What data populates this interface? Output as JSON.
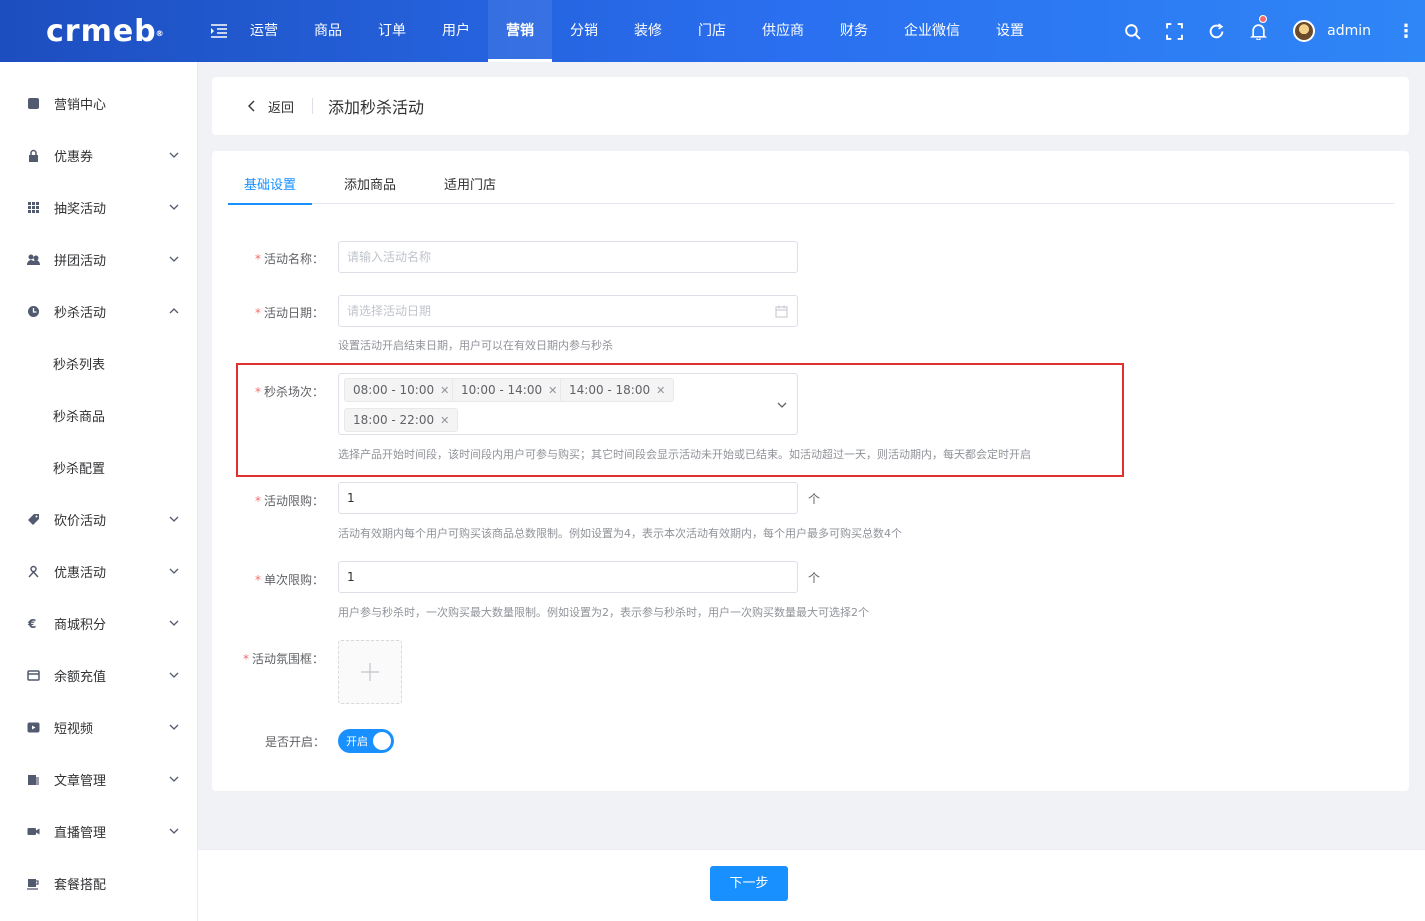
{
  "brand": {
    "logo_text": "crmeb",
    "logo_mark": "®"
  },
  "topnav": [
    "运营",
    "商品",
    "订单",
    "用户",
    "营销",
    "分销",
    "装修",
    "门店",
    "供应商",
    "财务",
    "企业微信",
    "设置"
  ],
  "topnav_active_index": 4,
  "user": {
    "name": "admin"
  },
  "colors": {
    "primary": "#1890ff",
    "header_start": "#1d4ebf",
    "header_end": "#2f86f6",
    "highlight": "#e0312e",
    "required": "#f56c6c"
  },
  "sidebar": [
    {
      "label": "营销中心",
      "icon": "marketing-center-icon",
      "expandable": false
    },
    {
      "label": "优惠券",
      "icon": "lock-icon",
      "expandable": true
    },
    {
      "label": "抽奖活动",
      "icon": "grid-icon",
      "expandable": true
    },
    {
      "label": "拼团活动",
      "icon": "group-icon",
      "expandable": true
    },
    {
      "label": "秒杀活动",
      "icon": "clock-icon",
      "expandable": true,
      "open": true,
      "children": [
        "秒杀列表",
        "秒杀商品",
        "秒杀配置"
      ]
    },
    {
      "label": "砍价活动",
      "icon": "tag-icon",
      "expandable": true
    },
    {
      "label": "优惠活动",
      "icon": "gift-icon",
      "expandable": true
    },
    {
      "label": "商城积分",
      "icon": "euro-icon",
      "expandable": true
    },
    {
      "label": "余额充值",
      "icon": "card-icon",
      "expandable": true
    },
    {
      "label": "短视频",
      "icon": "video-icon",
      "expandable": true
    },
    {
      "label": "文章管理",
      "icon": "article-icon",
      "expandable": true
    },
    {
      "label": "直播管理",
      "icon": "camera-icon",
      "expandable": true
    },
    {
      "label": "套餐搭配",
      "icon": "cup-icon",
      "expandable": false
    }
  ],
  "page": {
    "back_label": "返回",
    "title": "添加秒杀活动"
  },
  "tabs": [
    "基础设置",
    "添加商品",
    "适用门店"
  ],
  "tabs_active_index": 0,
  "form": {
    "name": {
      "label": "活动名称：",
      "placeholder": "请输入活动名称"
    },
    "date": {
      "label": "活动日期：",
      "placeholder": "请选择活动日期",
      "hint": "设置活动开启结束日期，用户可以在有效日期内参与秒杀"
    },
    "sessions": {
      "label": "秒杀场次：",
      "tags": [
        "08:00 - 10:00",
        "10:00 - 14:00",
        "14:00 - 18:00",
        "18:00 - 22:00"
      ],
      "hint": "选择产品开始时间段，该时间段内用户可参与购买；其它时间段会显示活动未开始或已结束。如活动超过一天，则活动期内，每天都会定时开启"
    },
    "limit": {
      "label": "活动限购：",
      "value": "1",
      "unit": "个",
      "hint": "活动有效期内每个用户可购买该商品总数限制。例如设置为4，表示本次活动有效期内，每个用户最多可购买总数4个"
    },
    "single_limit": {
      "label": "单次限购：",
      "value": "1",
      "unit": "个",
      "hint": "用户参与秒杀时，一次购买最大数量限制。例如设置为2，表示参与秒杀时，用户一次购买数量最大可选择2个"
    },
    "frame": {
      "label": "活动氛围框："
    },
    "enabled": {
      "label": "是否开启：",
      "switch_text": "开启",
      "value": true
    }
  },
  "footer": {
    "next_label": "下一步"
  }
}
